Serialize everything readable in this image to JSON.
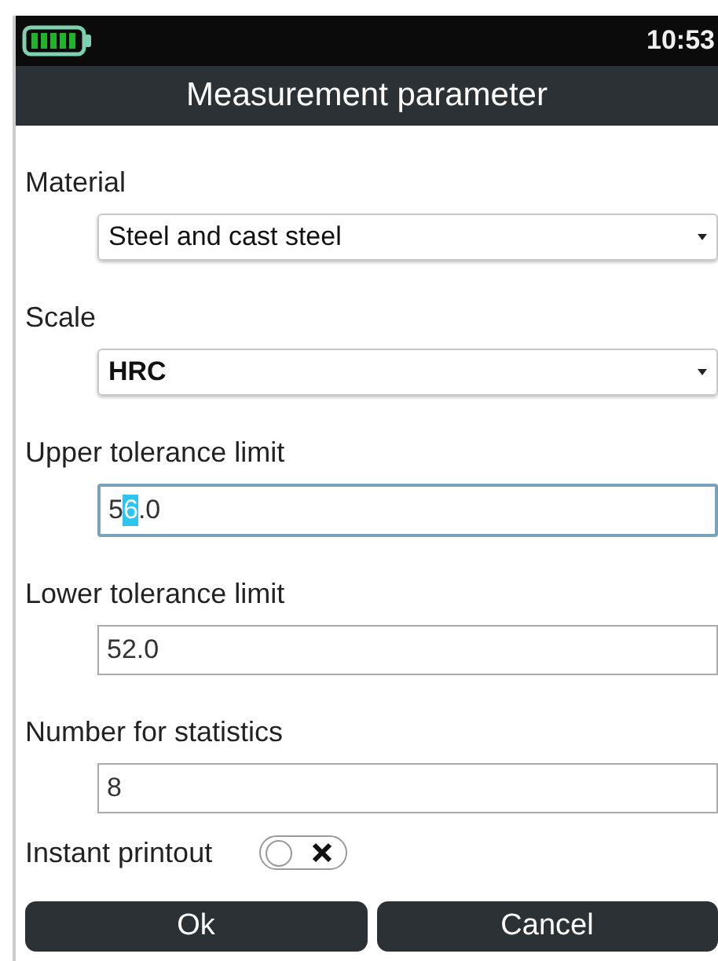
{
  "status_bar": {
    "time": "10:53"
  },
  "title": "Measurement parameter",
  "fields": [
    {
      "kind": "select",
      "label": "Material",
      "value": "Steel and cast steel",
      "bold": false
    },
    {
      "kind": "select",
      "label": "Scale",
      "value": "HRC",
      "bold": true
    },
    {
      "kind": "input",
      "label": "Upper tolerance limit",
      "focused": true,
      "value_parts": [
        {
          "text": "5",
          "selected": false
        },
        {
          "text": "6",
          "selected": true
        },
        {
          "text": ".0",
          "selected": false
        }
      ]
    },
    {
      "kind": "input",
      "label": "Lower tolerance limit",
      "focused": false,
      "value_parts": [
        {
          "text": "52.0",
          "selected": false
        }
      ]
    },
    {
      "kind": "input",
      "label": "Number for statistics",
      "focused": false,
      "value_parts": [
        {
          "text": "8",
          "selected": false
        }
      ]
    }
  ],
  "toggle": {
    "label": "Instant printout",
    "on": false
  },
  "buttons": [
    "Ok",
    "Cancel"
  ]
}
